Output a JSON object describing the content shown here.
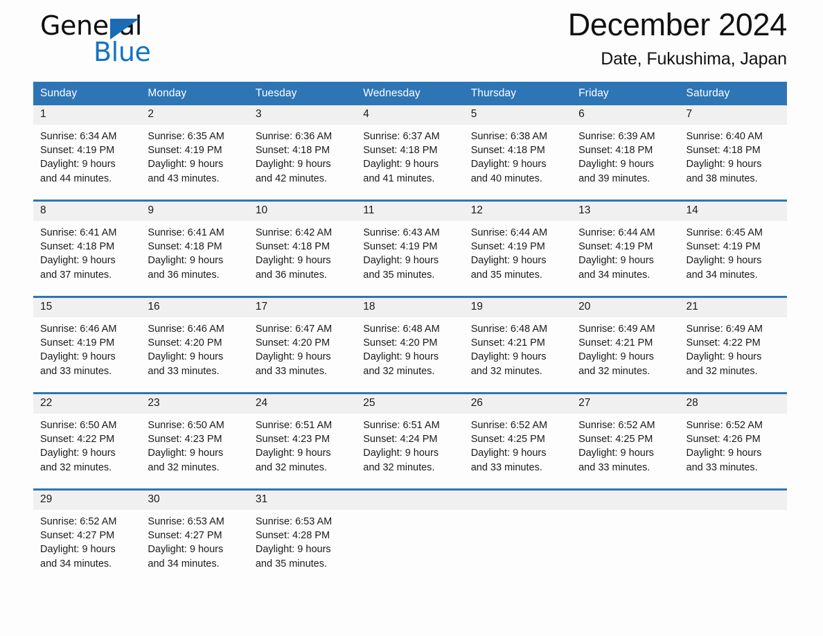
{
  "brand": {
    "line1": "General",
    "line2": "Blue",
    "triangle_color": "#1b6cb3",
    "blue_text_color": "#1573c4"
  },
  "header": {
    "title": "December 2024",
    "subtitle": "Date, Fukushima, Japan",
    "header_bg": "#2e75b6",
    "daynum_bg": "#f0f0f0"
  },
  "weekdays": [
    "Sunday",
    "Monday",
    "Tuesday",
    "Wednesday",
    "Thursday",
    "Friday",
    "Saturday"
  ],
  "weeks": [
    [
      {
        "day": "1",
        "sunrise": "Sunrise: 6:34 AM",
        "sunset": "Sunset: 4:19 PM",
        "daylight1": "Daylight: 9 hours",
        "daylight2": "and 44 minutes."
      },
      {
        "day": "2",
        "sunrise": "Sunrise: 6:35 AM",
        "sunset": "Sunset: 4:19 PM",
        "daylight1": "Daylight: 9 hours",
        "daylight2": "and 43 minutes."
      },
      {
        "day": "3",
        "sunrise": "Sunrise: 6:36 AM",
        "sunset": "Sunset: 4:18 PM",
        "daylight1": "Daylight: 9 hours",
        "daylight2": "and 42 minutes."
      },
      {
        "day": "4",
        "sunrise": "Sunrise: 6:37 AM",
        "sunset": "Sunset: 4:18 PM",
        "daylight1": "Daylight: 9 hours",
        "daylight2": "and 41 minutes."
      },
      {
        "day": "5",
        "sunrise": "Sunrise: 6:38 AM",
        "sunset": "Sunset: 4:18 PM",
        "daylight1": "Daylight: 9 hours",
        "daylight2": "and 40 minutes."
      },
      {
        "day": "6",
        "sunrise": "Sunrise: 6:39 AM",
        "sunset": "Sunset: 4:18 PM",
        "daylight1": "Daylight: 9 hours",
        "daylight2": "and 39 minutes."
      },
      {
        "day": "7",
        "sunrise": "Sunrise: 6:40 AM",
        "sunset": "Sunset: 4:18 PM",
        "daylight1": "Daylight: 9 hours",
        "daylight2": "and 38 minutes."
      }
    ],
    [
      {
        "day": "8",
        "sunrise": "Sunrise: 6:41 AM",
        "sunset": "Sunset: 4:18 PM",
        "daylight1": "Daylight: 9 hours",
        "daylight2": "and 37 minutes."
      },
      {
        "day": "9",
        "sunrise": "Sunrise: 6:41 AM",
        "sunset": "Sunset: 4:18 PM",
        "daylight1": "Daylight: 9 hours",
        "daylight2": "and 36 minutes."
      },
      {
        "day": "10",
        "sunrise": "Sunrise: 6:42 AM",
        "sunset": "Sunset: 4:18 PM",
        "daylight1": "Daylight: 9 hours",
        "daylight2": "and 36 minutes."
      },
      {
        "day": "11",
        "sunrise": "Sunrise: 6:43 AM",
        "sunset": "Sunset: 4:19 PM",
        "daylight1": "Daylight: 9 hours",
        "daylight2": "and 35 minutes."
      },
      {
        "day": "12",
        "sunrise": "Sunrise: 6:44 AM",
        "sunset": "Sunset: 4:19 PM",
        "daylight1": "Daylight: 9 hours",
        "daylight2": "and 35 minutes."
      },
      {
        "day": "13",
        "sunrise": "Sunrise: 6:44 AM",
        "sunset": "Sunset: 4:19 PM",
        "daylight1": "Daylight: 9 hours",
        "daylight2": "and 34 minutes."
      },
      {
        "day": "14",
        "sunrise": "Sunrise: 6:45 AM",
        "sunset": "Sunset: 4:19 PM",
        "daylight1": "Daylight: 9 hours",
        "daylight2": "and 34 minutes."
      }
    ],
    [
      {
        "day": "15",
        "sunrise": "Sunrise: 6:46 AM",
        "sunset": "Sunset: 4:19 PM",
        "daylight1": "Daylight: 9 hours",
        "daylight2": "and 33 minutes."
      },
      {
        "day": "16",
        "sunrise": "Sunrise: 6:46 AM",
        "sunset": "Sunset: 4:20 PM",
        "daylight1": "Daylight: 9 hours",
        "daylight2": "and 33 minutes."
      },
      {
        "day": "17",
        "sunrise": "Sunrise: 6:47 AM",
        "sunset": "Sunset: 4:20 PM",
        "daylight1": "Daylight: 9 hours",
        "daylight2": "and 33 minutes."
      },
      {
        "day": "18",
        "sunrise": "Sunrise: 6:48 AM",
        "sunset": "Sunset: 4:20 PM",
        "daylight1": "Daylight: 9 hours",
        "daylight2": "and 32 minutes."
      },
      {
        "day": "19",
        "sunrise": "Sunrise: 6:48 AM",
        "sunset": "Sunset: 4:21 PM",
        "daylight1": "Daylight: 9 hours",
        "daylight2": "and 32 minutes."
      },
      {
        "day": "20",
        "sunrise": "Sunrise: 6:49 AM",
        "sunset": "Sunset: 4:21 PM",
        "daylight1": "Daylight: 9 hours",
        "daylight2": "and 32 minutes."
      },
      {
        "day": "21",
        "sunrise": "Sunrise: 6:49 AM",
        "sunset": "Sunset: 4:22 PM",
        "daylight1": "Daylight: 9 hours",
        "daylight2": "and 32 minutes."
      }
    ],
    [
      {
        "day": "22",
        "sunrise": "Sunrise: 6:50 AM",
        "sunset": "Sunset: 4:22 PM",
        "daylight1": "Daylight: 9 hours",
        "daylight2": "and 32 minutes."
      },
      {
        "day": "23",
        "sunrise": "Sunrise: 6:50 AM",
        "sunset": "Sunset: 4:23 PM",
        "daylight1": "Daylight: 9 hours",
        "daylight2": "and 32 minutes."
      },
      {
        "day": "24",
        "sunrise": "Sunrise: 6:51 AM",
        "sunset": "Sunset: 4:23 PM",
        "daylight1": "Daylight: 9 hours",
        "daylight2": "and 32 minutes."
      },
      {
        "day": "25",
        "sunrise": "Sunrise: 6:51 AM",
        "sunset": "Sunset: 4:24 PM",
        "daylight1": "Daylight: 9 hours",
        "daylight2": "and 32 minutes."
      },
      {
        "day": "26",
        "sunrise": "Sunrise: 6:52 AM",
        "sunset": "Sunset: 4:25 PM",
        "daylight1": "Daylight: 9 hours",
        "daylight2": "and 33 minutes."
      },
      {
        "day": "27",
        "sunrise": "Sunrise: 6:52 AM",
        "sunset": "Sunset: 4:25 PM",
        "daylight1": "Daylight: 9 hours",
        "daylight2": "and 33 minutes."
      },
      {
        "day": "28",
        "sunrise": "Sunrise: 6:52 AM",
        "sunset": "Sunset: 4:26 PM",
        "daylight1": "Daylight: 9 hours",
        "daylight2": "and 33 minutes."
      }
    ],
    [
      {
        "day": "29",
        "sunrise": "Sunrise: 6:52 AM",
        "sunset": "Sunset: 4:27 PM",
        "daylight1": "Daylight: 9 hours",
        "daylight2": "and 34 minutes."
      },
      {
        "day": "30",
        "sunrise": "Sunrise: 6:53 AM",
        "sunset": "Sunset: 4:27 PM",
        "daylight1": "Daylight: 9 hours",
        "daylight2": "and 34 minutes."
      },
      {
        "day": "31",
        "sunrise": "Sunrise: 6:53 AM",
        "sunset": "Sunset: 4:28 PM",
        "daylight1": "Daylight: 9 hours",
        "daylight2": "and 35 minutes."
      },
      {
        "day": "",
        "sunrise": "",
        "sunset": "",
        "daylight1": "",
        "daylight2": ""
      },
      {
        "day": "",
        "sunrise": "",
        "sunset": "",
        "daylight1": "",
        "daylight2": ""
      },
      {
        "day": "",
        "sunrise": "",
        "sunset": "",
        "daylight1": "",
        "daylight2": ""
      },
      {
        "day": "",
        "sunrise": "",
        "sunset": "",
        "daylight1": "",
        "daylight2": ""
      }
    ]
  ]
}
